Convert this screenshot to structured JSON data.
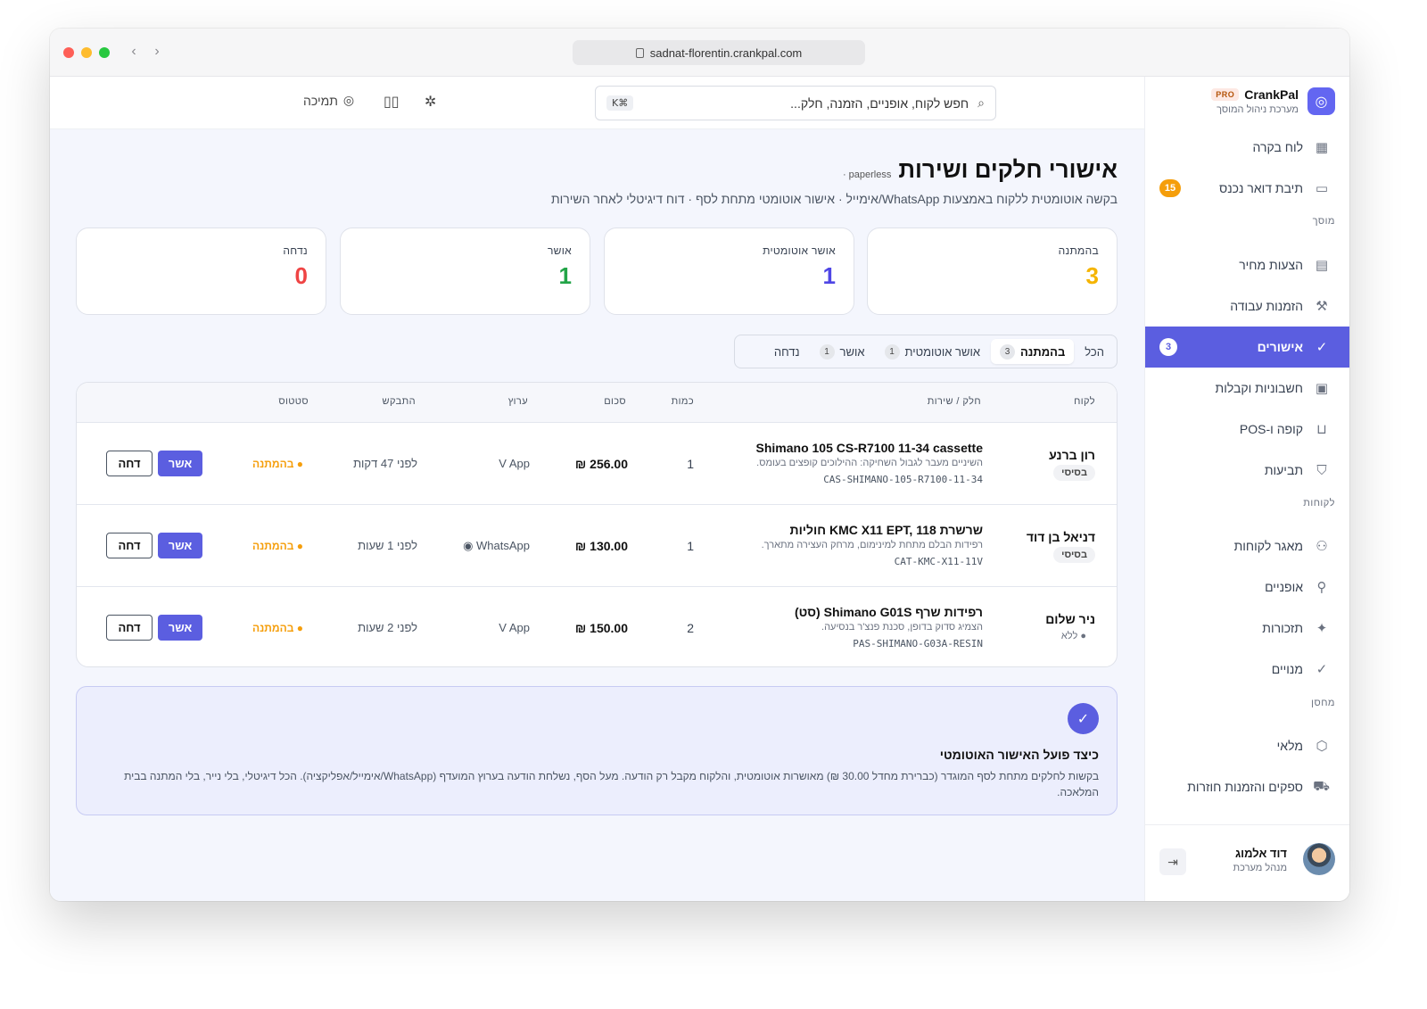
{
  "browser": {
    "url": "sadnat-florentin.crankpal.com"
  },
  "topbar": {
    "search_placeholder": "חפש לקוח, אופניים, הזמנה, חלק...",
    "search_shortcut": "⌘K",
    "support_label": "תמיכה"
  },
  "brand": {
    "name": "CrankPal",
    "badge": "PRO",
    "subtitle": "מערכת ניהול המוסך"
  },
  "sidebar": {
    "items": [
      {
        "label": "לוח בקרה",
        "icon": "dashboard-icon"
      },
      {
        "label": "תיבת דואר נכנס",
        "icon": "inbox-icon",
        "badge": "15"
      },
      {
        "label": "הצעות מחיר",
        "icon": "document-icon"
      },
      {
        "label": "הזמנות עבודה",
        "icon": "wrench-icon"
      },
      {
        "label": "אישורים",
        "icon": "check-circle-icon",
        "badge": "3",
        "active": true
      },
      {
        "label": "חשבוניות וקבלות",
        "icon": "receipt-icon"
      },
      {
        "label": "קופה ו-POS",
        "icon": "cart-icon"
      },
      {
        "label": "תביעות",
        "icon": "shield-icon"
      },
      {
        "label": "מאגר לקוחות",
        "icon": "users-icon"
      },
      {
        "label": "אופניים",
        "icon": "bike-icon"
      },
      {
        "label": "תזכורות",
        "icon": "sparkle-icon"
      },
      {
        "label": "מנויים",
        "icon": "check-circle-icon"
      },
      {
        "label": "מלאי",
        "icon": "box-icon"
      },
      {
        "label": "ספקים והזמנות חוזרות",
        "icon": "truck-icon"
      }
    ],
    "sections": {
      "garage": "מוסך",
      "customers": "לקוחות",
      "warehouse": "מחסן"
    }
  },
  "user": {
    "name": "דוד אלמוג",
    "role": "מנהל מערכת"
  },
  "page": {
    "title": "אישורי חלקים ושירות",
    "tag": "paperless ·",
    "subtitle": "בקשה אוטומטית ללקוח באמצעות WhatsApp/אימייל · אישור אוטומטי מתחת לסף · דוח דיגיטלי לאחר השירות"
  },
  "stats": [
    {
      "label": "בהמתנה",
      "value": "3",
      "color": "#f5b400"
    },
    {
      "label": "אושר אוטומטית",
      "value": "1",
      "color": "#4f46e5"
    },
    {
      "label": "אושר",
      "value": "1",
      "color": "#22a447"
    },
    {
      "label": "נדחה",
      "value": "0",
      "color": "#ef4444"
    }
  ],
  "tabs": [
    {
      "label": "הכל",
      "count": ""
    },
    {
      "label": "בהמתנה",
      "count": "3"
    },
    {
      "label": "אושר אוטומטית",
      "count": "1"
    },
    {
      "label": "אושר",
      "count": "1"
    },
    {
      "label": "נדחה",
      "count": ""
    }
  ],
  "table": {
    "headers": {
      "customer": "לקוח",
      "part": "חלק / שירות",
      "qty": "כמות",
      "amount": "סכום",
      "channel": "ערוץ",
      "requested": "התבקש",
      "status": "סטטוס"
    },
    "rows": [
      {
        "customer": "רון ברנע",
        "tier": "בסיסי",
        "part": "Shimano 105 CS-R7100 11-34 cassette",
        "desc": "השיניים מעבר לגבול השחיקה: ההילוכים קופצים בעומס.",
        "sku": "CAS-SHIMANO-105-R7100-11-34",
        "qty": "1",
        "amount": "₪ 256.00",
        "channel": "V App",
        "requested": "לפני 47 דקות",
        "status": "● בהמתנה",
        "approve": "אשר",
        "reject": "דחה"
      },
      {
        "customer": "דניאל בן דוד",
        "tier": "בסיסי",
        "part": "שרשרת KMC X11 EPT, 118 חוליות",
        "desc": "רפידות הבלם מתחת למינימום, מרחק העצירה מתארך.",
        "sku": "CAT-KMC-X11-11V",
        "qty": "1",
        "amount": "₪ 130.00",
        "channel": "◉ WhatsApp",
        "requested": "לפני 1 שעות",
        "status": "● בהמתנה",
        "approve": "אשר",
        "reject": "דחה"
      },
      {
        "customer": "ניר שלום",
        "tier": "● ללא",
        "part": "רפידות שרף Shimano G01S (סט)",
        "desc": "הצמיג סדוק בדופן, סכנת פנצ'ר בנסיעה.",
        "sku": "PAS-SHIMANO-G03A-RESIN",
        "qty": "2",
        "amount": "₪ 150.00",
        "channel": "V App",
        "requested": "לפני 2 שעות",
        "status": "● בהמתנה",
        "approve": "אשר",
        "reject": "דחה"
      }
    ]
  },
  "info": {
    "title": "כיצד פועל האישור האוטומטי",
    "text": "בקשות לחלקים מתחת לסף המוגדר (כברירת מחדל 30.00 ₪) מאושרות אוטומטית, והלקוח מקבל רק הודעה. מעל הסף, נשלחת הודעה בערוץ המועדף (WhatsApp/אימייל/אפליקציה). הכל דיגיטלי, בלי נייר, בלי המתנה בבית המלאכה."
  }
}
